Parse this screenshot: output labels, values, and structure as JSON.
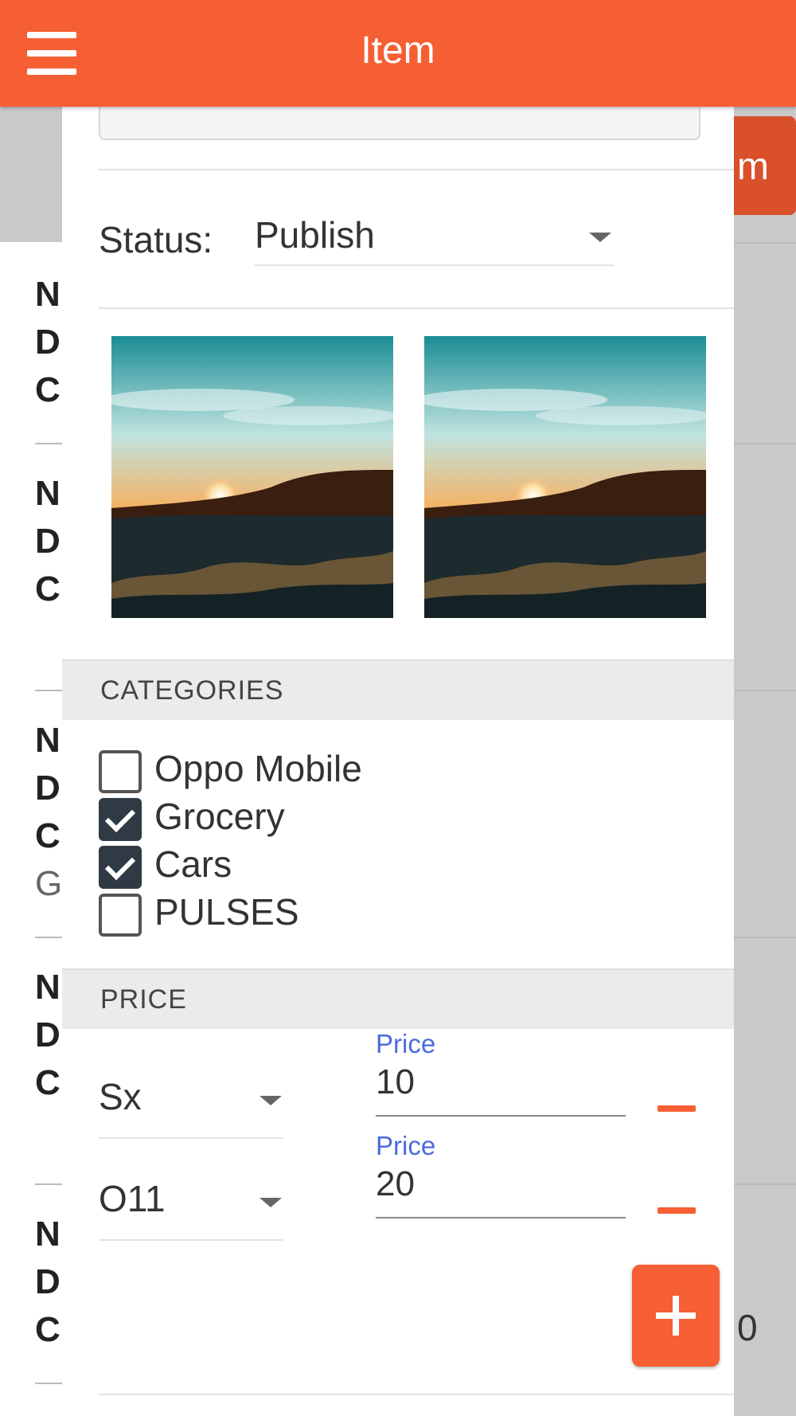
{
  "appbar": {
    "title": "Item",
    "menu_icon": "hamburger-menu-icon",
    "color": "#f55f33"
  },
  "background": {
    "right_button_label": "m",
    "right_bottom_text": "0",
    "rows": [
      {
        "lines": [
          "N",
          "D",
          "C"
        ]
      },
      {
        "lines": [
          "N",
          "D",
          "C"
        ]
      },
      {
        "lines": [
          "N",
          "D",
          "C",
          "G"
        ]
      },
      {
        "lines": [
          "N",
          "D",
          "C"
        ]
      },
      {
        "lines": [
          "N",
          "D",
          "C"
        ]
      }
    ]
  },
  "modal": {
    "status": {
      "label": "Status:",
      "value": "Publish"
    },
    "images": [
      {
        "name": "sunset-thumbnail-1"
      },
      {
        "name": "sunset-thumbnail-2"
      }
    ],
    "categories": {
      "heading": "CATEGORIES",
      "items": [
        {
          "label": "Oppo Mobile",
          "checked": false
        },
        {
          "label": "Grocery",
          "checked": true
        },
        {
          "label": "Cars",
          "checked": true
        },
        {
          "label": "PULSES",
          "checked": false
        }
      ]
    },
    "price": {
      "heading": "PRICE",
      "rows": [
        {
          "variant": "Sx",
          "label": "Price",
          "value": "10"
        },
        {
          "variant": "O11",
          "label": "Price",
          "value": "20"
        }
      ]
    },
    "add_button_icon": "plus-icon"
  }
}
